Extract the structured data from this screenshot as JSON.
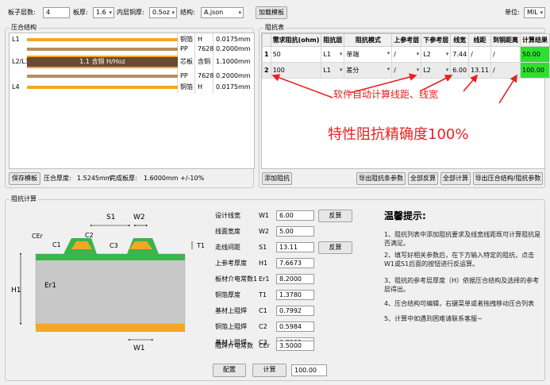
{
  "toolbar": {
    "layers_label": "板子层数:",
    "layers_value": "4",
    "thickness_label": "板厚:",
    "thickness_value": "1.6",
    "inner_cu_label": "内层铜厚:",
    "inner_cu_value": "0.5oz",
    "structure_label": "结构:",
    "structure_value": "A.json",
    "load_button": "加载模板",
    "unit_label": "单位:",
    "unit_value": "MIL"
  },
  "stackup": {
    "title": "压合结构",
    "rows": [
      {
        "name": "L1",
        "c1": "铜箔",
        "c2": "H",
        "c3": "0.0175mm"
      },
      {
        "name": "",
        "c1": "PP",
        "c2": "7628",
        "c3": "0.2000mm"
      },
      {
        "name": "L2/L3",
        "bar_text": "1.1 含铜 H/Hoz",
        "c1": "芯板",
        "c2": "含铜",
        "c3": "1.1000mm"
      },
      {
        "name": "",
        "c1": "PP",
        "c2": "7628",
        "c3": "0.2000mm"
      },
      {
        "name": "L4",
        "c1": "铜箔",
        "c2": "H",
        "c3": "0.0175mm"
      }
    ],
    "save_button": "保存模板",
    "press_thickness_label": "压合厚度:",
    "press_thickness_value": "1.5245mm",
    "finish_thickness_label": "完成板厚:",
    "finish_thickness_value": "1.6000mm +/-10%"
  },
  "impedance": {
    "title": "阻抗表",
    "headers": [
      "需求阻抗(ohm)",
      "阻抗层",
      "阻抗模式",
      "上参考层",
      "下参考层",
      "线宽",
      "线距",
      "到铜距离",
      "计算结果"
    ],
    "rows": [
      {
        "idx": "1",
        "req": "50",
        "layer": "L1",
        "mode": "单端",
        "top": "/",
        "bottom": "L2",
        "width": "7.44",
        "spacing": "/",
        "copper": "/",
        "result": "50.00"
      },
      {
        "idx": "2",
        "req": "100",
        "layer": "L1",
        "mode": "差分",
        "top": "/",
        "bottom": "L2",
        "width": "6.00",
        "spacing": "13.11",
        "copper": "/",
        "result": "100.00"
      }
    ],
    "annotation1": "软件自动计算线距、线宽",
    "annotation2": "特性阻抗精确度100%",
    "buttons": [
      "添加阻抗",
      "导出阻抗条参数",
      "全部反算",
      "全部计算",
      "导出压合结构/阻抗参数"
    ]
  },
  "calc": {
    "title": "阻抗计算",
    "diagram_labels": {
      "s1": "S1",
      "w2": "W2",
      "cer": "CEr",
      "c2": "C2",
      "c1": "C1",
      "c3": "C3",
      "t1": "T1",
      "h1": "H1",
      "er1": "Er1",
      "w1": "W1"
    },
    "params": [
      {
        "label": "设计线宽",
        "sym": "W1",
        "value": "6.00",
        "button": "反算"
      },
      {
        "label": "线面宽度",
        "sym": "W2",
        "value": "5.00"
      },
      {
        "label": "走线间距",
        "sym": "S1",
        "value": "13.11",
        "button": "反算"
      },
      {
        "label": "上参考厚度",
        "sym": "H1",
        "value": "7.6673"
      },
      {
        "label": "板材介电常数1",
        "sym": "Er1",
        "value": "8.2000"
      },
      {
        "label": "铜箔厚度",
        "sym": "T1",
        "value": "1.3780"
      },
      {
        "label": "基材上阻焊",
        "sym": "C1",
        "value": "0.7992"
      },
      {
        "label": "铜箔上阻焊",
        "sym": "C2",
        "value": "0.5984"
      },
      {
        "label": "基材上阻焊",
        "sym": "C3",
        "value": "0.7992"
      },
      {
        "label": "阻焊介电常数",
        "sym": "CEr",
        "value": "3.5000"
      }
    ],
    "config_button": "配置",
    "calc_button": "计算",
    "result_value": "100.00"
  },
  "tips": {
    "title": "温馨提示:",
    "items": [
      "1、阻抗列表中添加阻抗要求及线宽线距既可计算阻抗是否满足。",
      "2、填写好相关参数后，在下方输入特定的阻抗，点击W1或S1后面的按钮进行反运算。",
      "3、阻抗的参考层厚度（H）依据压合结构及选择的参考层得出。",
      "4、压合结构可编辑，右键菜单或者拖拽移动压合列表",
      "5、计算中如遇到困难请联系客服~"
    ]
  },
  "colors": {
    "copper": "#f5a623",
    "prepreg": "#b88e5a",
    "core": "#6b4a2f",
    "result_green": "#2ee02e",
    "annotation_red": "#e82020",
    "solder_mask": "#3ab54a",
    "dielectric": "#c8c8c8"
  }
}
